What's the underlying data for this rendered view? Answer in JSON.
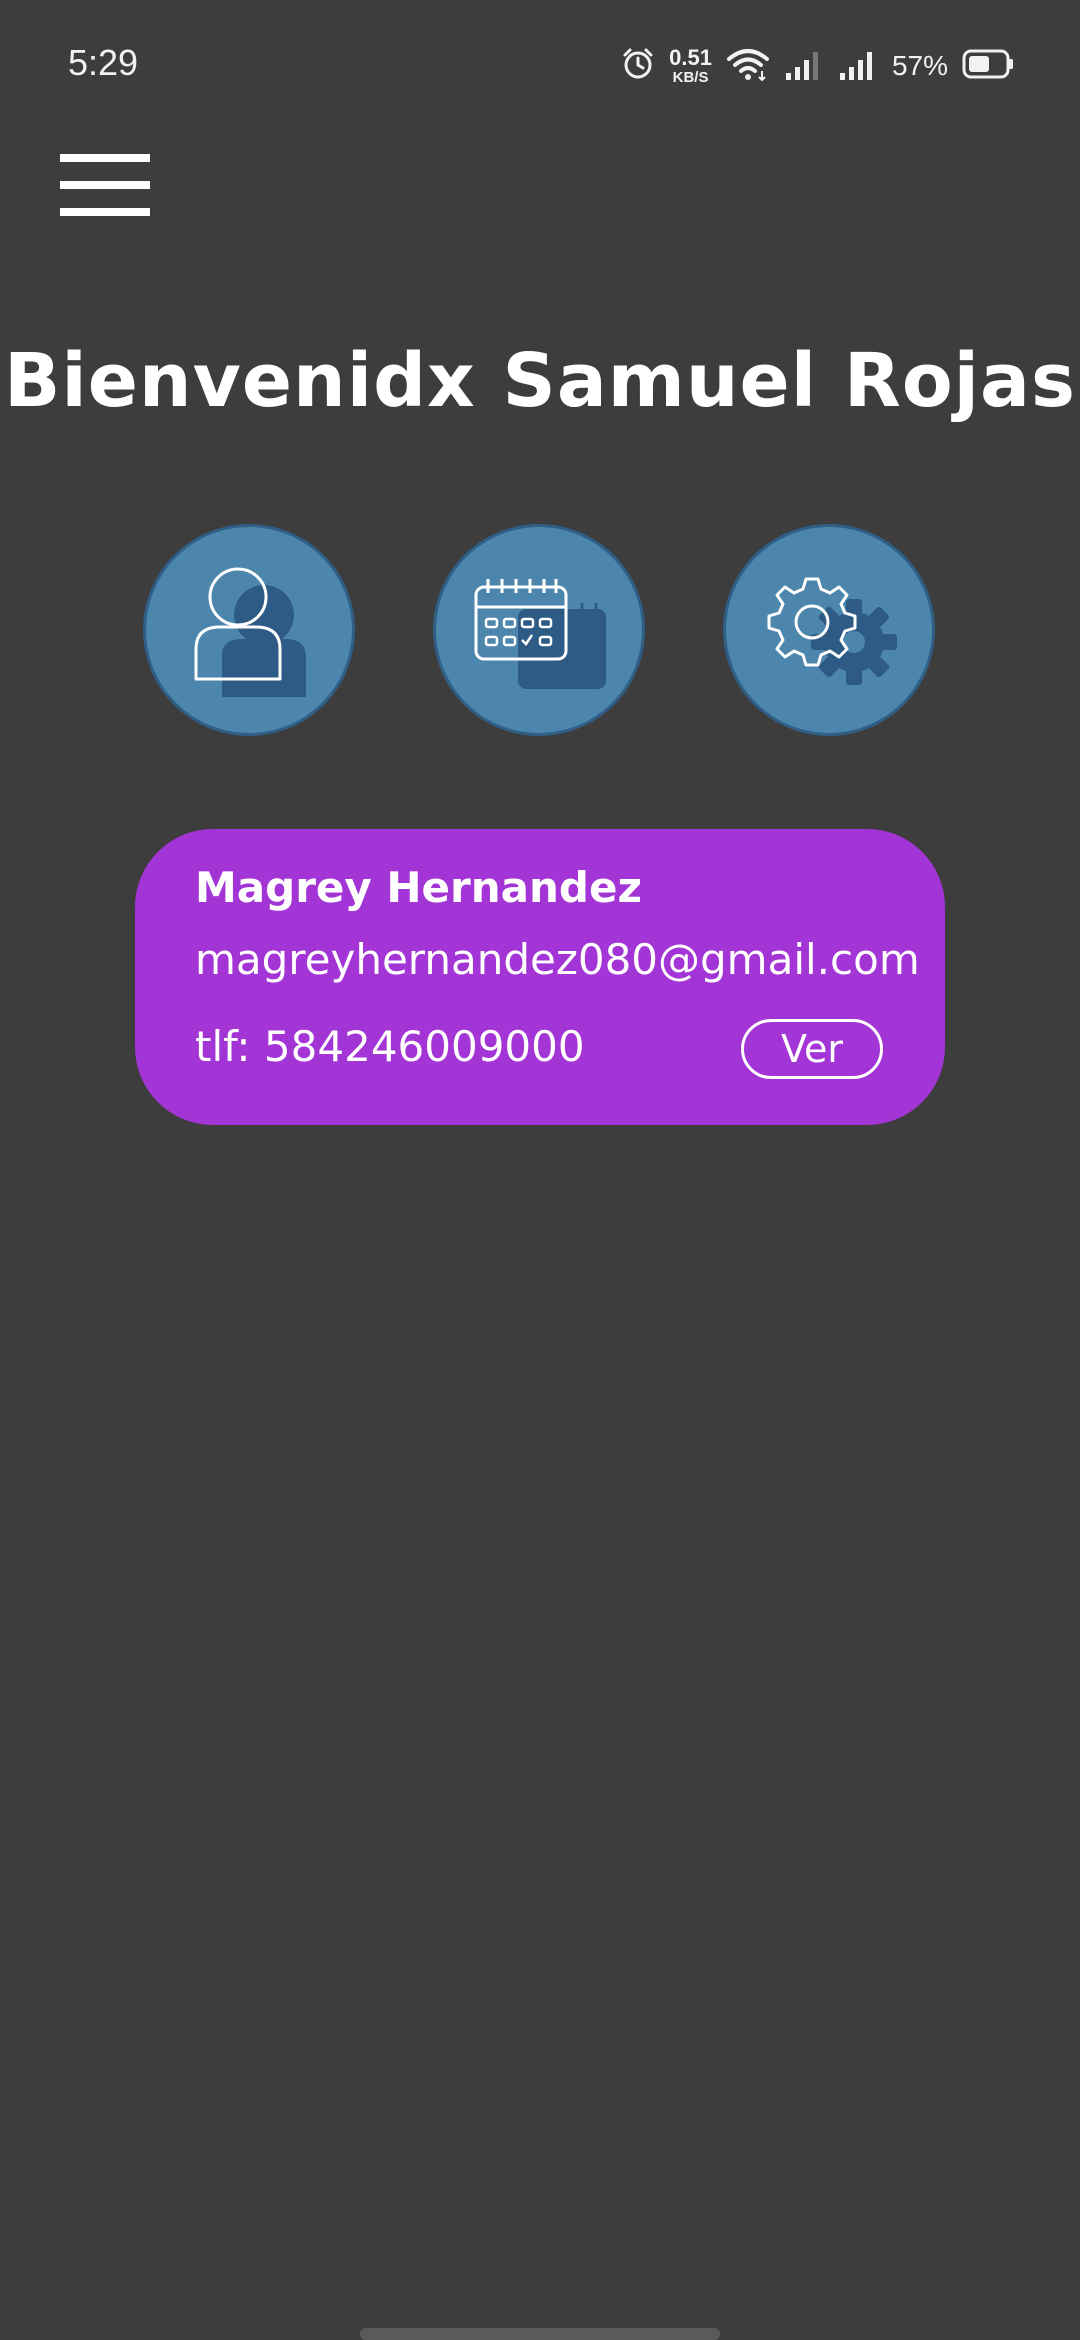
{
  "status_bar": {
    "time": "5:29",
    "network_speed_value": "0.51",
    "network_speed_unit": "KB/S",
    "battery_percent": "57%",
    "icons": [
      "alarm-icon",
      "wifi-icon",
      "signal-icon",
      "signal-icon",
      "battery-icon"
    ]
  },
  "header": {
    "menu_icon": "hamburger-menu-icon",
    "title": "Bienvenidx Samuel Rojas"
  },
  "quick_actions": [
    {
      "icon": "user-profile-icon"
    },
    {
      "icon": "calendar-icon"
    },
    {
      "icon": "settings-gear-icon"
    }
  ],
  "contact_card": {
    "name": "Magrey Hernandez",
    "email": "magreyhernandez080@gmail.com",
    "phone": "tlf: 584246009000",
    "view_label": "Ver"
  },
  "colors": {
    "background": "#3d3d3e",
    "circle_fill": "#4c86ad",
    "circle_shadow": "#2f5f86",
    "card": "#a335d6"
  }
}
